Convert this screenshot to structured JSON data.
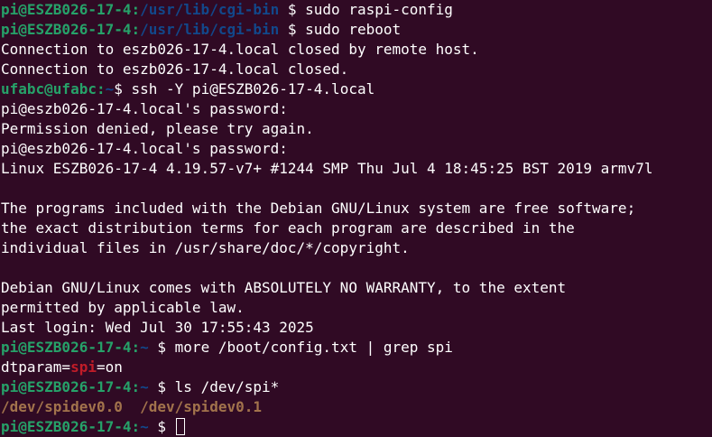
{
  "colors": {
    "background": "#300a24",
    "foreground": "#ffffff",
    "prompt_user_host": "#26a269",
    "prompt_path": "#12488b",
    "prompt_dollar": "#ffffff",
    "grep_match": "#c01c28",
    "file_listing": "#a2734c"
  },
  "terminal": {
    "lines": [
      [
        {
          "text": "pi@ESZB026-17-4:",
          "color": "#26a269",
          "bold": true
        },
        {
          "text": "/usr/lib/cgi-bin",
          "color": "#12488b",
          "bold": true
        },
        {
          "text": " $ sudo raspi-config",
          "color": "#ffffff",
          "bold": false
        }
      ],
      [
        {
          "text": "pi@ESZB026-17-4:",
          "color": "#26a269",
          "bold": true
        },
        {
          "text": "/usr/lib/cgi-bin",
          "color": "#12488b",
          "bold": true
        },
        {
          "text": " $ sudo reboot",
          "color": "#ffffff",
          "bold": false
        }
      ],
      [
        {
          "text": "Connection to eszb026-17-4.local closed by remote host.",
          "color": "#ffffff",
          "bold": false
        }
      ],
      [
        {
          "text": "Connection to eszb026-17-4.local closed.",
          "color": "#ffffff",
          "bold": false
        }
      ],
      [
        {
          "text": "ufabc@ufabc:",
          "color": "#26a269",
          "bold": true
        },
        {
          "text": "~",
          "color": "#12488b",
          "bold": true
        },
        {
          "text": "$ ssh -Y pi@ESZB026-17-4.local",
          "color": "#ffffff",
          "bold": false
        }
      ],
      [
        {
          "text": "pi@eszb026-17-4.local's password:",
          "color": "#ffffff",
          "bold": false
        }
      ],
      [
        {
          "text": "Permission denied, please try again.",
          "color": "#ffffff",
          "bold": false
        }
      ],
      [
        {
          "text": "pi@eszb026-17-4.local's password:",
          "color": "#ffffff",
          "bold": false
        }
      ],
      [
        {
          "text": "Linux ESZB026-17-4 4.19.57-v7+ #1244 SMP Thu Jul 4 18:45:25 BST 2019 armv7l",
          "color": "#ffffff",
          "bold": false
        }
      ],
      [
        {
          "text": "",
          "color": "#ffffff",
          "bold": false
        }
      ],
      [
        {
          "text": "The programs included with the Debian GNU/Linux system are free software;",
          "color": "#ffffff",
          "bold": false
        }
      ],
      [
        {
          "text": "the exact distribution terms for each program are described in the",
          "color": "#ffffff",
          "bold": false
        }
      ],
      [
        {
          "text": "individual files in /usr/share/doc/*/copyright.",
          "color": "#ffffff",
          "bold": false
        }
      ],
      [
        {
          "text": "",
          "color": "#ffffff",
          "bold": false
        }
      ],
      [
        {
          "text": "Debian GNU/Linux comes with ABSOLUTELY NO WARRANTY, to the extent",
          "color": "#ffffff",
          "bold": false
        }
      ],
      [
        {
          "text": "permitted by applicable law.",
          "color": "#ffffff",
          "bold": false
        }
      ],
      [
        {
          "text": "Last login: Wed Jul 30 17:55:43 2025",
          "color": "#ffffff",
          "bold": false
        }
      ],
      [
        {
          "text": "pi@ESZB026-17-4:",
          "color": "#26a269",
          "bold": true
        },
        {
          "text": "~",
          "color": "#12488b",
          "bold": true
        },
        {
          "text": " $ more /boot/config.txt | grep spi",
          "color": "#ffffff",
          "bold": false
        }
      ],
      [
        {
          "text": "dtparam=",
          "color": "#ffffff",
          "bold": false
        },
        {
          "text": "spi",
          "color": "#c01c28",
          "bold": true
        },
        {
          "text": "=on",
          "color": "#ffffff",
          "bold": false
        }
      ],
      [
        {
          "text": "pi@ESZB026-17-4:",
          "color": "#26a269",
          "bold": true
        },
        {
          "text": "~",
          "color": "#12488b",
          "bold": true
        },
        {
          "text": " $ ls /dev/spi*",
          "color": "#ffffff",
          "bold": false
        }
      ],
      [
        {
          "text": "/dev/spidev0.0",
          "color": "#a2734c",
          "bold": true
        },
        {
          "text": "  ",
          "color": "#ffffff",
          "bold": false
        },
        {
          "text": "/dev/spidev0.1",
          "color": "#a2734c",
          "bold": true
        }
      ],
      [
        {
          "text": "pi@ESZB026-17-4:",
          "color": "#26a269",
          "bold": true
        },
        {
          "text": "~",
          "color": "#12488b",
          "bold": true
        },
        {
          "text": " $ ",
          "color": "#ffffff",
          "bold": false
        }
      ]
    ],
    "cursor_line": 21
  }
}
